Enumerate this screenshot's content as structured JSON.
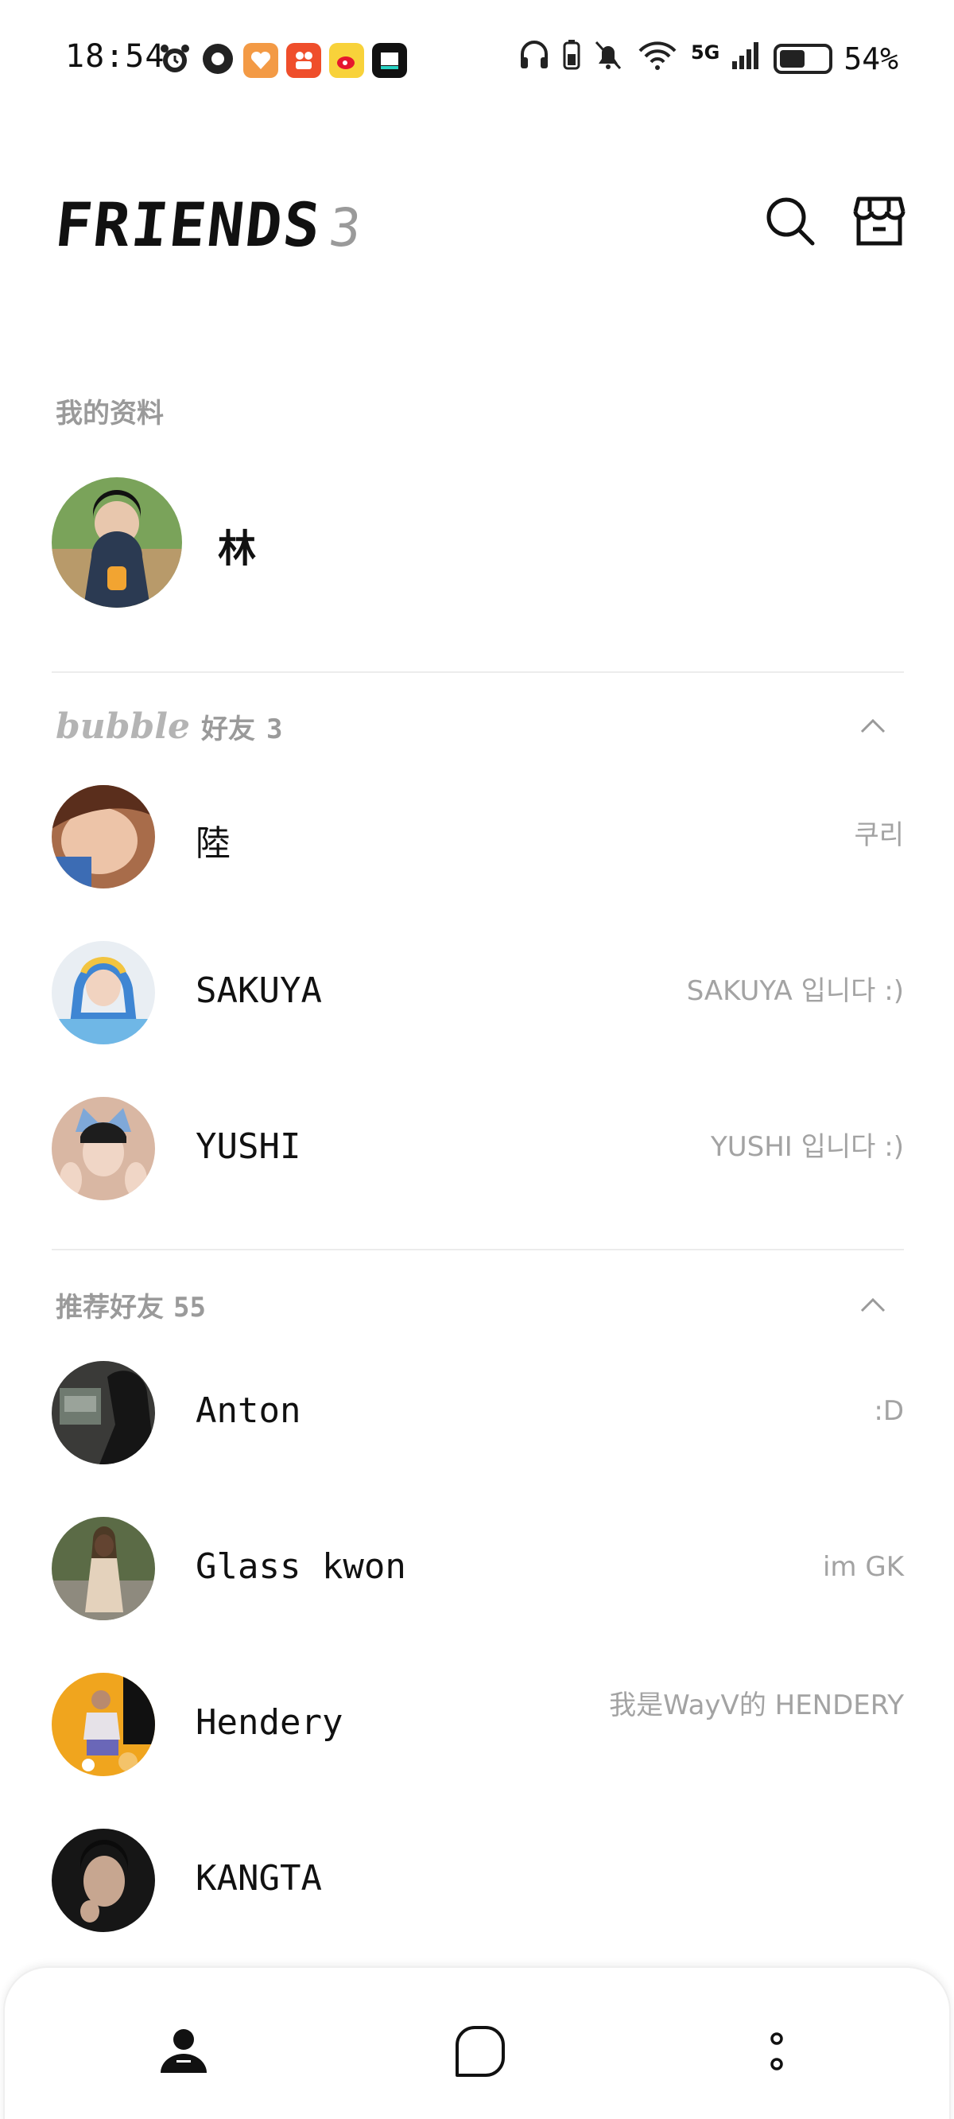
{
  "status_bar": {
    "time": "18:54",
    "network": "5G",
    "battery": "54%",
    "battery_level": 0.54
  },
  "header": {
    "title": "FRIENDS",
    "count": "3"
  },
  "my_profile": {
    "section_label": "我的资料",
    "name": "林"
  },
  "bubble_section": {
    "label_brand": "bubble",
    "label_text": "好友",
    "count": "3",
    "friends": [
      {
        "name": "陸",
        "status": "쿠리"
      },
      {
        "name": "SAKUYA",
        "status": "SAKUYA 입니다 :)"
      },
      {
        "name": "YUSHI",
        "status": "YUSHI 입니다 :)"
      }
    ]
  },
  "recommended_section": {
    "label": "推荐好友",
    "count": "55",
    "friends": [
      {
        "name": "Anton",
        "status": ":D"
      },
      {
        "name": "Glass kwon",
        "status": "im GK"
      },
      {
        "name": "Hendery",
        "status": "我是WayV的 HENDERY"
      },
      {
        "name": "KANGTA",
        "status": ""
      }
    ]
  },
  "colors": {
    "accent_text": "#111111",
    "muted_text": "#9a9a9a",
    "divider": "#ececec"
  }
}
